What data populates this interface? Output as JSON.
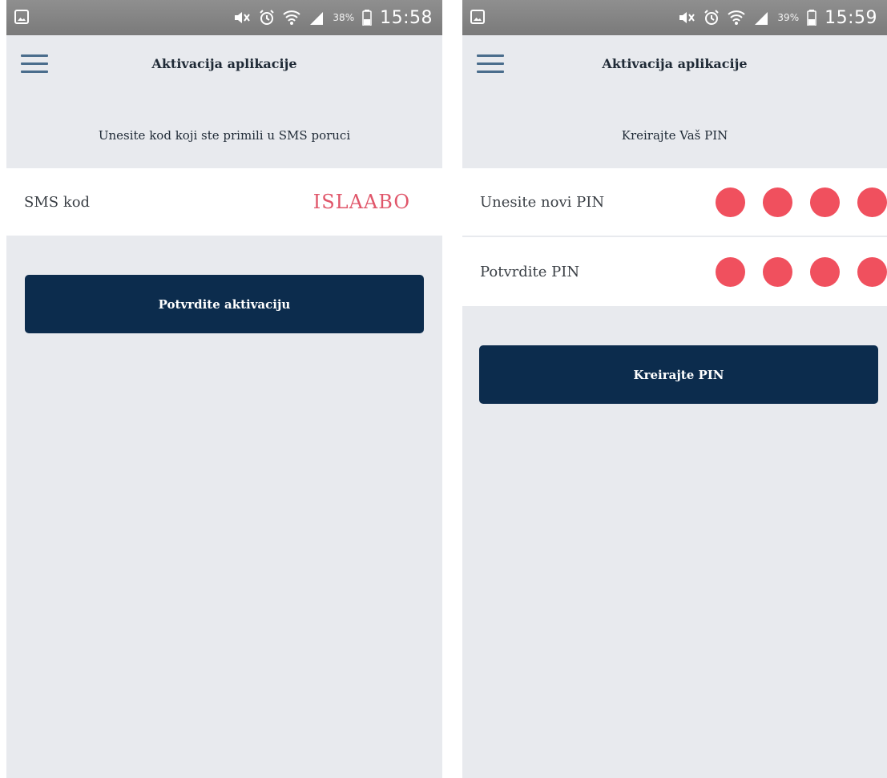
{
  "left_screen": {
    "status_bar": {
      "time": "15:58",
      "battery_percent": "38%"
    },
    "header": {
      "title": "Aktivacija aplikacije"
    },
    "instruction": "Unesite kod koji ste primili u SMS poruci",
    "sms_field": {
      "label": "SMS kod",
      "value": "ISLAABO"
    },
    "confirm_button": {
      "label": "Potvrdite aktivaciju"
    }
  },
  "right_screen": {
    "status_bar": {
      "time": "15:59",
      "battery_percent": "39%"
    },
    "header": {
      "title": "Aktivacija aplikacije"
    },
    "instruction": "Kreirajte Vaš PIN",
    "new_pin_field": {
      "label": "Unesite novi PIN",
      "filled_digits": 4
    },
    "confirm_pin_field": {
      "label": "Potvrdite PIN",
      "filled_digits": 4
    },
    "create_button": {
      "label": "Kreirajte PIN"
    }
  },
  "colors": {
    "background": "#e8eaee",
    "status_bar": "#858585",
    "accent_red": "#e0566a",
    "pin_dot": "#f0505e",
    "button": "#0c2c4d",
    "menu_icon": "#4a6d8c"
  },
  "icons": {
    "status_left": "gallery-icon",
    "status_right": [
      "mute-icon",
      "alarm-icon",
      "wifi-icon",
      "signal-icon",
      "battery-icon"
    ],
    "header": "hamburger-menu-icon"
  }
}
